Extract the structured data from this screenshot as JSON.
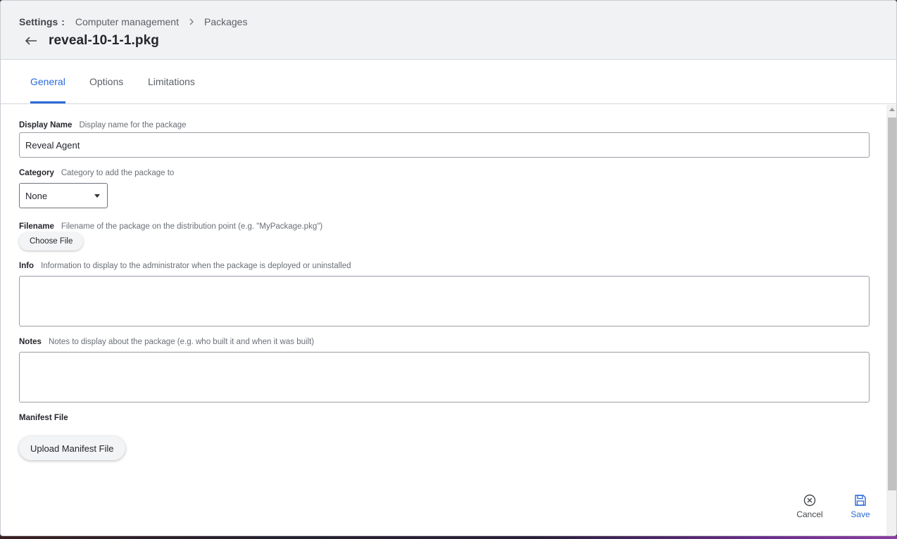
{
  "breadcrumb": {
    "root": "Settings",
    "separator": ":",
    "items": [
      "Computer management",
      "Packages"
    ]
  },
  "title": "reveal-10-1-1.pkg",
  "tabs": [
    {
      "label": "General",
      "active": true
    },
    {
      "label": "Options",
      "active": false
    },
    {
      "label": "Limitations",
      "active": false
    }
  ],
  "form": {
    "display_name": {
      "label": "Display Name",
      "description": "Display name for the package",
      "value": "Reveal Agent"
    },
    "category": {
      "label": "Category",
      "description": "Category to add the package to",
      "selected": "None"
    },
    "filename": {
      "label": "Filename",
      "description": "Filename of the package on the distribution point (e.g. \"MyPackage.pkg\")",
      "button": "Choose File"
    },
    "info": {
      "label": "Info",
      "description": "Information to display to the administrator when the package is deployed or uninstalled",
      "value": ""
    },
    "notes": {
      "label": "Notes",
      "description": "Notes to display about the package (e.g. who built it and when it was built)",
      "value": ""
    },
    "manifest": {
      "label": "Manifest File",
      "button": "Upload Manifest File"
    }
  },
  "actions": {
    "cancel": "Cancel",
    "save": "Save"
  },
  "colors": {
    "accent": "#2a6ad8"
  }
}
